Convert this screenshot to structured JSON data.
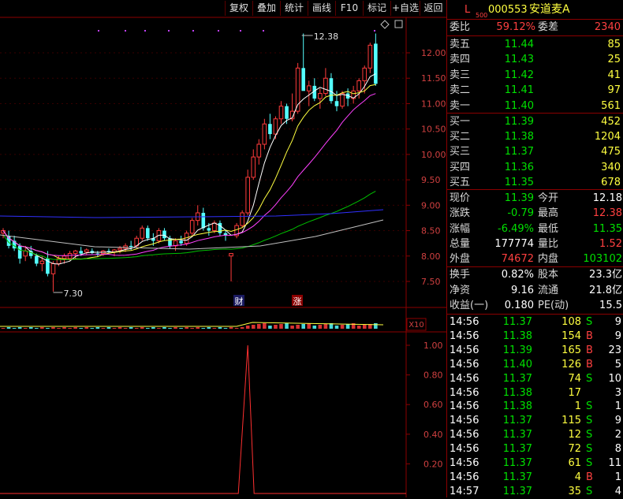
{
  "toolbar": {
    "buttons": [
      "复权",
      "叠加",
      "统计",
      "画线",
      "F10",
      "标记",
      "+自选",
      "返回"
    ]
  },
  "header": {
    "level_letter": "L",
    "level_sub": "500",
    "code": "000553",
    "name": "安道麦A"
  },
  "main_chart": {
    "high_marker": "12.38",
    "low_marker": "7.30",
    "y_ticks": [
      "12.00",
      "11.50",
      "11.00",
      "10.50",
      "10.00",
      "9.50",
      "9.00",
      "8.50",
      "8.00",
      "7.50"
    ],
    "event_tags": [
      "财",
      "涨"
    ],
    "volume_scale": "X10"
  },
  "indicator": {
    "y_ticks": [
      "1.00",
      "0.80",
      "0.60",
      "0.40",
      "0.20"
    ]
  },
  "chart_data": {
    "type": "candlestick",
    "ylim": [
      7.3,
      12.38
    ],
    "candles": [
      {
        "o": 8.45,
        "h": 8.55,
        "l": 8.35,
        "c": 8.5
      },
      {
        "o": 8.4,
        "h": 8.5,
        "l": 8.15,
        "c": 8.2
      },
      {
        "o": 8.3,
        "h": 8.4,
        "l": 8.1,
        "c": 8.15
      },
      {
        "o": 8.2,
        "h": 8.25,
        "l": 7.85,
        "c": 7.95
      },
      {
        "o": 8.0,
        "h": 8.2,
        "l": 7.9,
        "c": 8.1
      },
      {
        "o": 8.1,
        "h": 8.2,
        "l": 7.95,
        "c": 8.0
      },
      {
        "o": 8.0,
        "h": 8.05,
        "l": 7.8,
        "c": 7.85
      },
      {
        "o": 7.85,
        "h": 8.0,
        "l": 7.7,
        "c": 7.9
      },
      {
        "o": 7.95,
        "h": 8.1,
        "l": 7.6,
        "c": 7.65
      },
      {
        "o": 7.65,
        "h": 7.9,
        "l": 7.3,
        "c": 7.85
      },
      {
        "o": 7.85,
        "h": 8.0,
        "l": 7.8,
        "c": 7.95
      },
      {
        "o": 7.95,
        "h": 8.05,
        "l": 7.85,
        "c": 8.0
      },
      {
        "o": 7.95,
        "h": 8.1,
        "l": 7.9,
        "c": 8.05
      },
      {
        "o": 8.05,
        "h": 8.12,
        "l": 7.95,
        "c": 8.1
      },
      {
        "o": 8.1,
        "h": 8.18,
        "l": 8.0,
        "c": 8.05
      },
      {
        "o": 8.08,
        "h": 8.15,
        "l": 8.02,
        "c": 8.12
      },
      {
        "o": 8.1,
        "h": 8.15,
        "l": 8.04,
        "c": 8.06
      },
      {
        "o": 8.05,
        "h": 8.1,
        "l": 7.98,
        "c": 8.04
      },
      {
        "o": 8.05,
        "h": 8.12,
        "l": 8.0,
        "c": 8.1
      },
      {
        "o": 8.1,
        "h": 8.15,
        "l": 8.05,
        "c": 8.08
      },
      {
        "o": 8.08,
        "h": 8.14,
        "l": 8.0,
        "c": 8.12
      },
      {
        "o": 8.12,
        "h": 8.2,
        "l": 8.05,
        "c": 8.15
      },
      {
        "o": 8.15,
        "h": 8.25,
        "l": 8.08,
        "c": 8.2
      },
      {
        "o": 8.2,
        "h": 8.3,
        "l": 8.12,
        "c": 8.18
      },
      {
        "o": 8.2,
        "h": 8.4,
        "l": 8.15,
        "c": 8.35
      },
      {
        "o": 8.35,
        "h": 8.6,
        "l": 8.3,
        "c": 8.55
      },
      {
        "o": 8.55,
        "h": 8.6,
        "l": 8.3,
        "c": 8.35
      },
      {
        "o": 8.35,
        "h": 8.45,
        "l": 8.2,
        "c": 8.3
      },
      {
        "o": 8.3,
        "h": 8.55,
        "l": 8.25,
        "c": 8.5
      },
      {
        "o": 8.5,
        "h": 8.55,
        "l": 8.3,
        "c": 8.35
      },
      {
        "o": 8.35,
        "h": 8.4,
        "l": 8.15,
        "c": 8.2
      },
      {
        "o": 8.2,
        "h": 8.35,
        "l": 8.1,
        "c": 8.3
      },
      {
        "o": 8.3,
        "h": 8.4,
        "l": 8.2,
        "c": 8.25
      },
      {
        "o": 8.25,
        "h": 8.5,
        "l": 8.2,
        "c": 8.45
      },
      {
        "o": 8.45,
        "h": 8.75,
        "l": 8.4,
        "c": 8.7
      },
      {
        "o": 8.7,
        "h": 9.0,
        "l": 8.6,
        "c": 8.85
      },
      {
        "o": 8.85,
        "h": 8.95,
        "l": 8.5,
        "c": 8.55
      },
      {
        "o": 8.55,
        "h": 8.65,
        "l": 8.4,
        "c": 8.5
      },
      {
        "o": 8.5,
        "h": 8.7,
        "l": 8.45,
        "c": 8.65
      },
      {
        "o": 8.65,
        "h": 8.7,
        "l": 8.4,
        "c": 8.45
      },
      {
        "o": 8.45,
        "h": 8.5,
        "l": 8.3,
        "c": 8.4
      },
      {
        "o": 8.0,
        "h": 8.05,
        "l": 7.5,
        "c": 8.05
      },
      {
        "o": 8.4,
        "h": 8.65,
        "l": 8.35,
        "c": 8.6
      },
      {
        "o": 8.6,
        "h": 8.9,
        "l": 8.55,
        "c": 8.85
      },
      {
        "o": 8.85,
        "h": 9.7,
        "l": 8.8,
        "c": 9.55
      },
      {
        "o": 9.55,
        "h": 10.1,
        "l": 9.5,
        "c": 9.95
      },
      {
        "o": 9.95,
        "h": 10.3,
        "l": 9.8,
        "c": 10.2
      },
      {
        "o": 10.2,
        "h": 10.7,
        "l": 10.1,
        "c": 10.6
      },
      {
        "o": 10.6,
        "h": 10.8,
        "l": 10.3,
        "c": 10.4
      },
      {
        "o": 10.4,
        "h": 10.75,
        "l": 10.3,
        "c": 10.7
      },
      {
        "o": 10.7,
        "h": 11.05,
        "l": 10.6,
        "c": 10.95
      },
      {
        "o": 10.95,
        "h": 11.0,
        "l": 10.6,
        "c": 10.7
      },
      {
        "o": 10.7,
        "h": 11.2,
        "l": 10.65,
        "c": 10.85
      },
      {
        "o": 10.85,
        "h": 11.8,
        "l": 10.8,
        "c": 11.7
      },
      {
        "o": 11.7,
        "h": 12.38,
        "l": 11.6,
        "c": 11.25
      },
      {
        "o": 11.25,
        "h": 11.45,
        "l": 10.95,
        "c": 11.35
      },
      {
        "o": 11.35,
        "h": 11.5,
        "l": 11.05,
        "c": 11.1
      },
      {
        "o": 11.1,
        "h": 11.3,
        "l": 10.9,
        "c": 11.2
      },
      {
        "o": 11.2,
        "h": 11.7,
        "l": 11.15,
        "c": 11.5
      },
      {
        "o": 11.5,
        "h": 11.6,
        "l": 11.0,
        "c": 11.05
      },
      {
        "o": 11.05,
        "h": 11.25,
        "l": 10.85,
        "c": 10.95
      },
      {
        "o": 10.95,
        "h": 11.25,
        "l": 10.9,
        "c": 11.2
      },
      {
        "o": 11.2,
        "h": 11.3,
        "l": 10.95,
        "c": 11.1
      },
      {
        "o": 11.1,
        "h": 11.35,
        "l": 11.0,
        "c": 11.25
      },
      {
        "o": 11.25,
        "h": 11.5,
        "l": 11.1,
        "c": 11.45
      },
      {
        "o": 11.45,
        "h": 11.75,
        "l": 11.2,
        "c": 11.7
      },
      {
        "o": 11.7,
        "h": 12.2,
        "l": 11.6,
        "c": 12.15
      },
      {
        "o": 12.18,
        "h": 12.38,
        "l": 11.35,
        "c": 11.39
      }
    ],
    "indicator_values": [
      0,
      0,
      0,
      0,
      0,
      0,
      0,
      0,
      0,
      0,
      0,
      0,
      0,
      0,
      0,
      0,
      0,
      0,
      0,
      0,
      0,
      0,
      0,
      0,
      0,
      0,
      0,
      0,
      0,
      0,
      0,
      0,
      0,
      0,
      0,
      0,
      0,
      0,
      0,
      0,
      0,
      0,
      0,
      0,
      1,
      0,
      0,
      0,
      0,
      0,
      0,
      0,
      0,
      0,
      0,
      0,
      0,
      0,
      0,
      0,
      0,
      0,
      0,
      0,
      0,
      0,
      0,
      0
    ]
  },
  "quote": {
    "weibi_label": "委比",
    "weibi_value": "59.12%",
    "weicha_label": "委差",
    "weicha_value": "2340",
    "sell": [
      {
        "label": "卖五",
        "price": "11.44",
        "vol": "85"
      },
      {
        "label": "卖四",
        "price": "11.43",
        "vol": "25"
      },
      {
        "label": "卖三",
        "price": "11.42",
        "vol": "41"
      },
      {
        "label": "卖二",
        "price": "11.41",
        "vol": "97"
      },
      {
        "label": "卖一",
        "price": "11.40",
        "vol": "561"
      }
    ],
    "buy": [
      {
        "label": "买一",
        "price": "11.39",
        "vol": "452"
      },
      {
        "label": "买二",
        "price": "11.38",
        "vol": "1204"
      },
      {
        "label": "买三",
        "price": "11.37",
        "vol": "475"
      },
      {
        "label": "买四",
        "price": "11.36",
        "vol": "340"
      },
      {
        "label": "买五",
        "price": "11.35",
        "vol": "678"
      }
    ],
    "stats": [
      {
        "l1": "现价",
        "v1": "11.39",
        "c1": "green",
        "l2": "今开",
        "v2": "12.18",
        "c2": "white"
      },
      {
        "l1": "涨跌",
        "v1": "-0.79",
        "c1": "green",
        "l2": "最高",
        "v2": "12.38",
        "c2": "red"
      },
      {
        "l1": "涨幅",
        "v1": "-6.49%",
        "c1": "green",
        "l2": "最低",
        "v2": "11.35",
        "c2": "green"
      },
      {
        "l1": "总量",
        "v1": "177774",
        "c1": "white",
        "l2": "量比",
        "v2": "1.52",
        "c2": "red"
      },
      {
        "l1": "外盘",
        "v1": "74672",
        "c1": "red",
        "l2": "内盘",
        "v2": "103102",
        "c2": "green"
      }
    ],
    "fin": [
      {
        "l1": "换手",
        "v1": "0.82%",
        "l2": "股本",
        "v2": "23.3亿"
      },
      {
        "l1": "净资",
        "v1": "9.16",
        "l2": "流通",
        "v2": "21.8亿"
      },
      {
        "l1": "收益(一)",
        "v1": "0.180",
        "l2": "PE(动)",
        "v2": "15.5"
      }
    ],
    "ticks": [
      {
        "time": "14:56",
        "price": "11.37",
        "vol": "108",
        "side": "S",
        "n": "9"
      },
      {
        "time": "14:56",
        "price": "11.38",
        "vol": "154",
        "side": "B",
        "n": "9"
      },
      {
        "time": "14:56",
        "price": "11.39",
        "vol": "165",
        "side": "B",
        "n": "23"
      },
      {
        "time": "14:56",
        "price": "11.40",
        "vol": "126",
        "side": "B",
        "n": "5"
      },
      {
        "time": "14:56",
        "price": "11.37",
        "vol": "74",
        "side": "S",
        "n": "10"
      },
      {
        "time": "14:56",
        "price": "11.38",
        "vol": "17",
        "side": "",
        "n": "3"
      },
      {
        "time": "14:56",
        "price": "11.38",
        "vol": "1",
        "side": "S",
        "n": "1"
      },
      {
        "time": "14:56",
        "price": "11.37",
        "vol": "115",
        "side": "S",
        "n": "9"
      },
      {
        "time": "14:56",
        "price": "11.37",
        "vol": "12",
        "side": "S",
        "n": "2"
      },
      {
        "time": "14:56",
        "price": "11.37",
        "vol": "72",
        "side": "S",
        "n": "8"
      },
      {
        "time": "14:56",
        "price": "11.37",
        "vol": "61",
        "side": "S",
        "n": "11"
      },
      {
        "time": "14:56",
        "price": "11.37",
        "vol": "4",
        "side": "B",
        "n": "1"
      },
      {
        "time": "14:57",
        "price": "11.37",
        "vol": "35",
        "side": "S",
        "n": "4"
      }
    ]
  }
}
